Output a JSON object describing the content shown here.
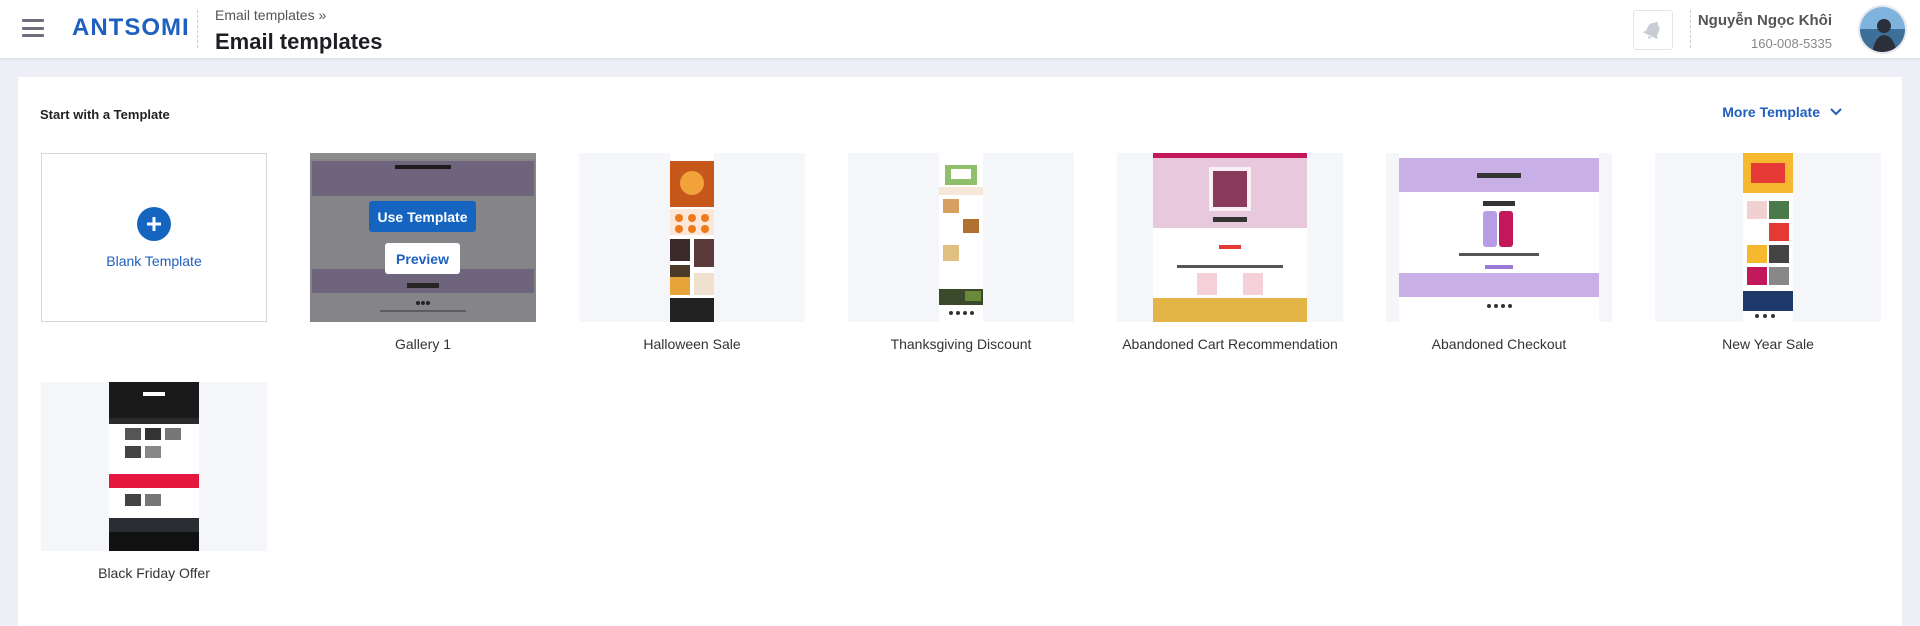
{
  "header": {
    "breadcrumb": "Email templates »",
    "title": "Email templates",
    "logo": "ANTSOMI",
    "user": {
      "name": "Nguyễn Ngọc Khôi",
      "phone": "160-008-5335"
    }
  },
  "main": {
    "section_title": "Start with a Template",
    "more_label": "More Template",
    "blank_label": "Blank Template",
    "use_label": "Use Template",
    "preview_label": "Preview",
    "templates": [
      {
        "name": "Gallery 1"
      },
      {
        "name": "Halloween Sale"
      },
      {
        "name": "Thanksgiving Discount"
      },
      {
        "name": "Abandoned Cart Recommendation"
      },
      {
        "name": "Abandoned Checkout"
      },
      {
        "name": "New Year Sale"
      },
      {
        "name": "Black Friday Offer"
      }
    ]
  },
  "colors": {
    "accent": "#1565c0",
    "brand": "#1f5fbf"
  },
  "icons": [
    "menu-icon",
    "bell-icon",
    "plus-icon",
    "chevron-down-icon"
  ]
}
